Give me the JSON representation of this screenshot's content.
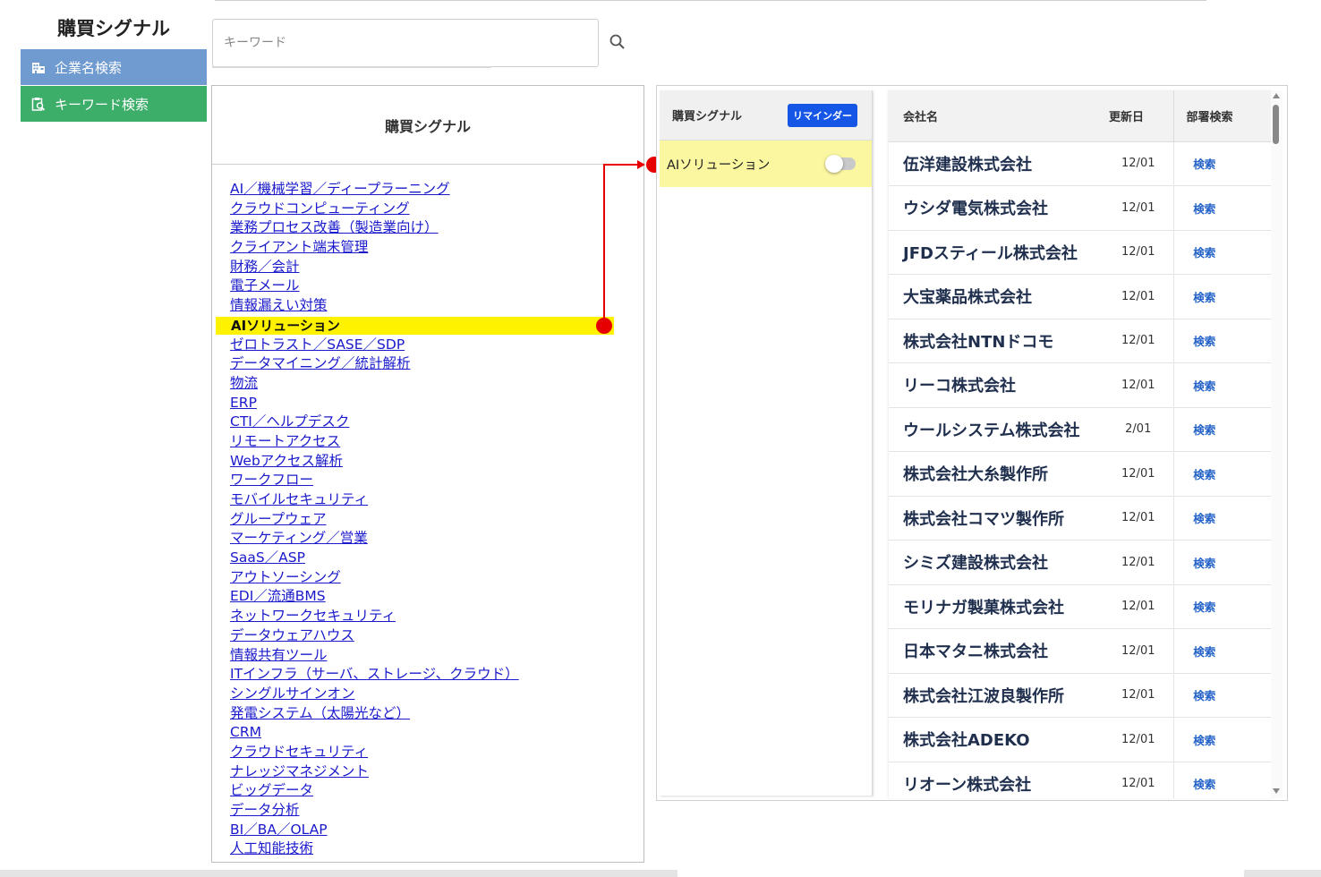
{
  "app": {
    "title": "購買シグナル"
  },
  "sidebar": {
    "items": [
      {
        "label": "企業名検索",
        "icon": "building-icon",
        "color": "#6f9bd0"
      },
      {
        "label": "キーワード検索",
        "icon": "clipboard-search-icon",
        "color": "#3dae6a"
      }
    ]
  },
  "search": {
    "placeholder": "キーワード",
    "value": "",
    "icon": "search-icon"
  },
  "signal_panel": {
    "title": "購買シグナル",
    "items": [
      "AI／機械学習／ディープラーニング",
      "クラウドコンピューティング",
      "業務プロセス改善（製造業向け）",
      "クライアント端末管理",
      "財務／会計",
      "電子メール",
      "情報漏えい対策",
      "AIソリューション",
      "ゼロトラスト／SASE／SDP",
      "データマイニング／統計解析",
      "物流",
      "ERP",
      "CTI／ヘルプデスク",
      "リモートアクセス",
      "Webアクセス解析",
      "ワークフロー",
      "モバイルセキュリティ",
      "グループウェア",
      "マーケティング／営業",
      "SaaS／ASP",
      "アウトソーシング",
      "EDI／流通BMS",
      "ネットワークセキュリティ",
      "データウェアハウス",
      "情報共有ツール",
      "ITインフラ（サーバ、ストレージ、クラウド）",
      "シングルサインオン",
      "発電システム（太陽光など）",
      "CRM",
      "クラウドセキュリティ",
      "ナレッジマネジメント",
      "ビッグデータ",
      "データ分析",
      "BI／BA／OLAP",
      "人工知能技術"
    ],
    "active_label": "AIソリューション",
    "highlight_color": "#fff200",
    "connector_color": "#e60000"
  },
  "reminder_panel": {
    "title": "購買シグナル",
    "badge": "リマインダー",
    "badge_color": "#1556e6",
    "row_label": "AIソリューション",
    "row_color": "#fbf7a0",
    "toggle_on": false
  },
  "company_table": {
    "headers": {
      "name": "会社名",
      "date": "更新日",
      "dept": "部署検索"
    },
    "rows": [
      {
        "name": "伍洋建設株式会社",
        "date": "12/01",
        "action": "検索"
      },
      {
        "name": "ウシダ電気株式会社",
        "date": "12/01",
        "action": "検索"
      },
      {
        "name": "JFDスティール株式会社",
        "date": "12/01",
        "action": "検索"
      },
      {
        "name": "大宝薬品株式会社",
        "date": "12/01",
        "action": "検索"
      },
      {
        "name": "株式会社NTNドコモ",
        "date": "12/01",
        "action": "検索"
      },
      {
        "name": "リーコ株式会社",
        "date": "12/01",
        "action": "検索"
      },
      {
        "name": "ウールシステム株式会社",
        "date": "2/01",
        "action": "検索"
      },
      {
        "name": "株式会社大糸製作所",
        "date": "12/01",
        "action": "検索"
      },
      {
        "name": "株式会社コマツ製作所",
        "date": "12/01",
        "action": "検索"
      },
      {
        "name": "シミズ建設株式会社",
        "date": "12/01",
        "action": "検索"
      },
      {
        "name": "モリナガ製菓株式会社",
        "date": "12/01",
        "action": "検索"
      },
      {
        "name": "日本マタニ株式会社",
        "date": "12/01",
        "action": "検索"
      },
      {
        "name": "株式会社江波良製作所",
        "date": "12/01",
        "action": "検索"
      },
      {
        "name": "株式会社ADEKO",
        "date": "12/01",
        "action": "検索"
      },
      {
        "name": "リオーン株式会社",
        "date": "12/01",
        "action": "検索"
      }
    ]
  }
}
